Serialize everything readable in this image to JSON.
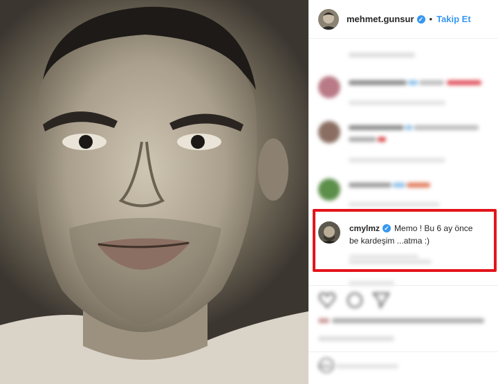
{
  "post": {
    "username": "mehmet.gunsur",
    "separator": "•",
    "follow_label": "Takip Et"
  },
  "highlighted_comment": {
    "username": "cmylmz",
    "text_line1": "Memo ! Bu 6 ay önce",
    "text_line2": "be kardeşim ...atma :)"
  },
  "colors": {
    "accent": "#3897f0",
    "highlight_border": "#e3141b"
  },
  "icons": [
    "verified-badge-icon",
    "heart-icon",
    "comment-icon",
    "share-icon",
    "emoji-icon"
  ]
}
